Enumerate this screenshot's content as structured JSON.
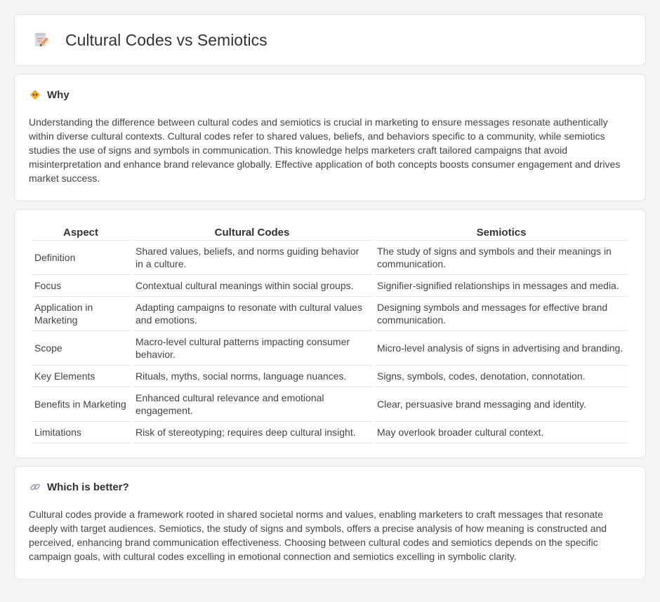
{
  "header": {
    "title": "Cultural Codes vs Semiotics",
    "icon": "document-pencil-icon"
  },
  "why": {
    "title": "Why",
    "icon": "diamond-sign-icon",
    "text": "Understanding the difference between cultural codes and semiotics is crucial in marketing to ensure messages resonate authentically within diverse cultural contexts. Cultural codes refer to shared values, beliefs, and behaviors specific to a community, while semiotics studies the use of signs and symbols in communication. This knowledge helps marketers craft tailored campaigns that avoid misinterpretation and enhance brand relevance globally. Effective application of both concepts boosts consumer engagement and drives market success."
  },
  "comparison": {
    "headers": [
      "Aspect",
      "Cultural Codes",
      "Semiotics"
    ],
    "rows": [
      [
        "Definition",
        "Shared values, beliefs, and norms guiding behavior in a culture.",
        "The study of signs and symbols and their meanings in communication."
      ],
      [
        "Focus",
        "Contextual cultural meanings within social groups.",
        "Signifier-signified relationships in messages and media."
      ],
      [
        "Application in Marketing",
        "Adapting campaigns to resonate with cultural values and emotions.",
        "Designing symbols and messages for effective brand communication."
      ],
      [
        "Scope",
        "Macro-level cultural patterns impacting consumer behavior.",
        "Micro-level analysis of signs in advertising and branding."
      ],
      [
        "Key Elements",
        "Rituals, myths, social norms, language nuances.",
        "Signs, symbols, codes, denotation, connotation."
      ],
      [
        "Benefits in Marketing",
        "Enhanced cultural relevance and emotional engagement.",
        "Clear, persuasive brand messaging and identity."
      ],
      [
        "Limitations",
        "Risk of stereotyping; requires deep cultural insight.",
        "May overlook broader cultural context."
      ]
    ]
  },
  "better": {
    "title": "Which is better?",
    "icon": "link-icon",
    "text": "Cultural codes provide a framework rooted in shared societal norms and values, enabling marketers to craft messages that resonate deeply with target audiences. Semiotics, the study of signs and symbols, offers a precise analysis of how meaning is constructed and perceived, enhancing brand communication effectiveness. Choosing between cultural codes and semiotics depends on the specific campaign goals, with cultural codes excelling in emotional connection and semiotics excelling in symbolic clarity."
  }
}
